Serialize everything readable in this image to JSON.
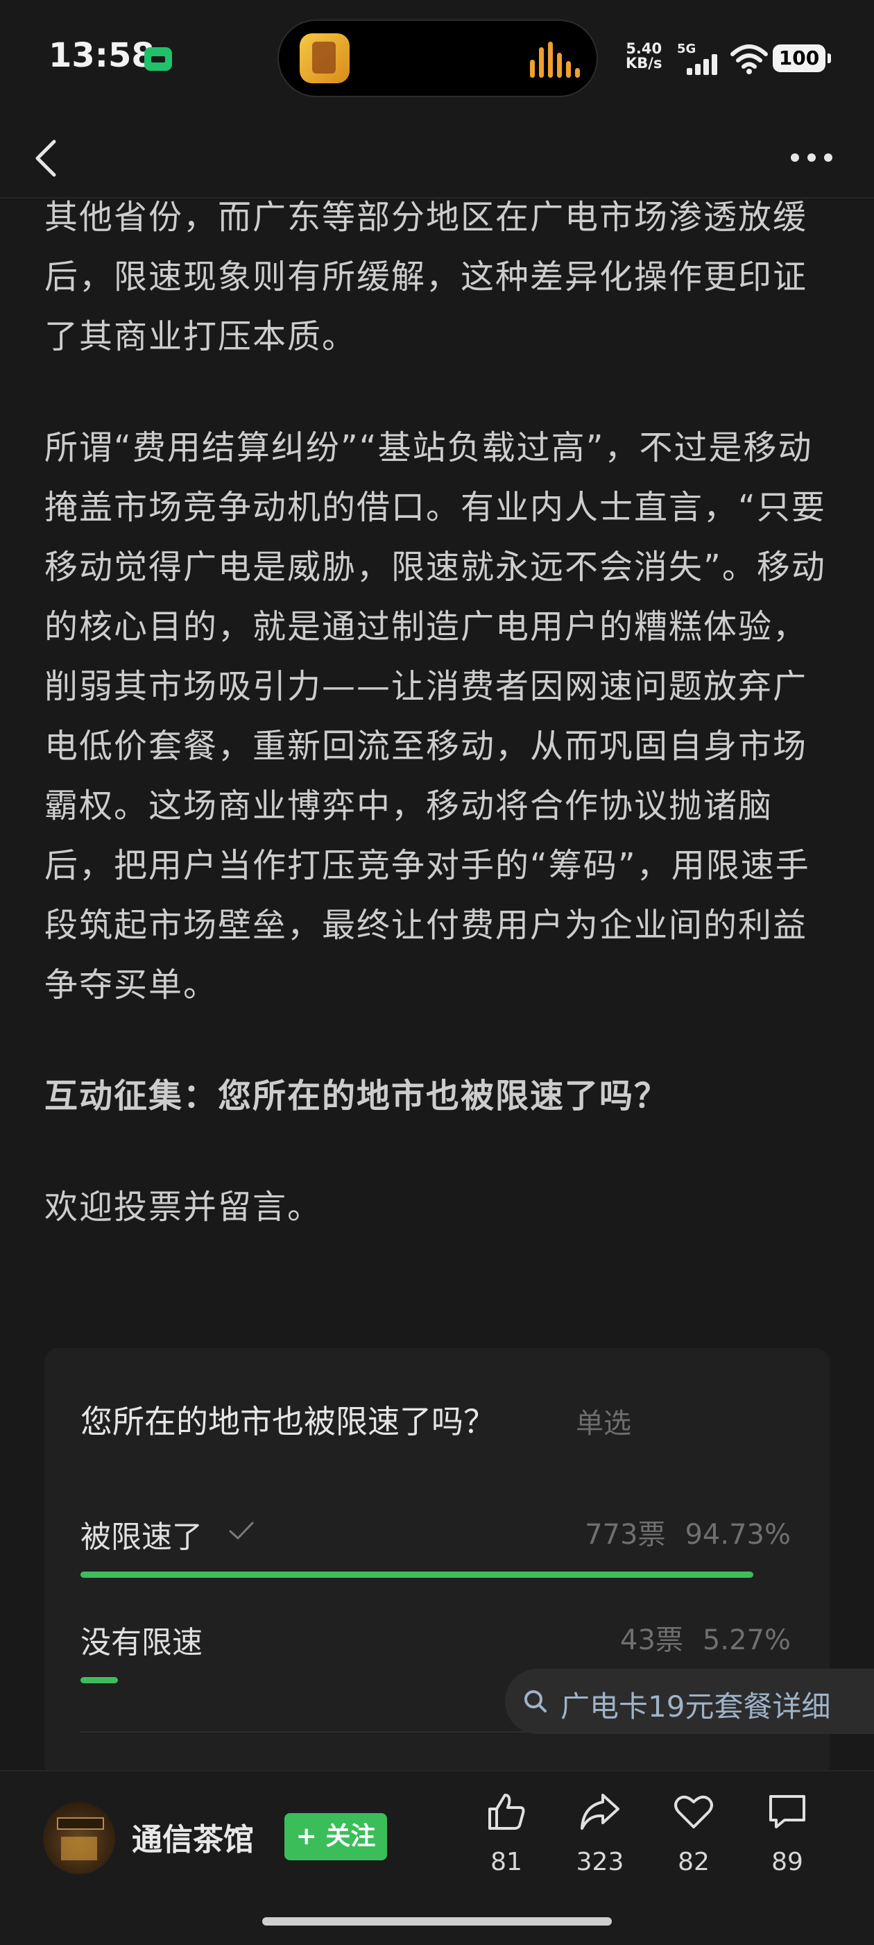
{
  "status_bar": {
    "time": "13:58",
    "net_speed_value": "5.40",
    "net_speed_unit": "KB/s",
    "network": "5G",
    "battery": "100"
  },
  "article": {
    "paragraphs": [
      "其他省份，而广东等部分地区在广电市场渗透放缓后，限速现象则有所缓解，这种差异化操作更印证了其商业打压本质。",
      "所谓“费用结算纠纷”“基站负载过高”，不过是移动掩盖市场竞争动机的借口。有业内人士直言，“只要移动觉得广电是威胁，限速就永远不会消失”。移动的核心目的，就是通过制造广电用户的糟糕体验，削弱其市场吸引力——让消费者因网速问题放弃广电低价套餐，重新回流至移动，从而巩固自身市场霸权。这场商业博弈中，移动将合作协议抛诸脑后，把用户当作打压竞争对手的“筹码”，用限速手段筑起市场壁垒，最终让付费用户为企业间的利益争夺买单。",
      "互动征集：您所在的地市也被限速了吗？",
      "欢迎投票并留言。"
    ]
  },
  "poll": {
    "question": "您所在的地市也被限速了吗？",
    "type": "单选",
    "options": [
      {
        "label": "被限速了",
        "votes": "773票",
        "percent": "94.73%",
        "share": 0.9473,
        "selected": true
      },
      {
        "label": "没有限速",
        "votes": "43票",
        "percent": "5.27%",
        "share": 0.0527,
        "selected": false
      }
    ]
  },
  "search_suggestion": "广电卡19元套餐详细",
  "bottom_bar": {
    "author": "通信茶馆",
    "follow_label": "+ 关注",
    "like_count": "81",
    "share_count": "323",
    "favorite_count": "82",
    "comment_count": "89"
  },
  "colors": {
    "background": "#191919",
    "accent_green": "#3bbd5a",
    "text": "#cdcdcd",
    "muted": "#6f6f6f"
  }
}
